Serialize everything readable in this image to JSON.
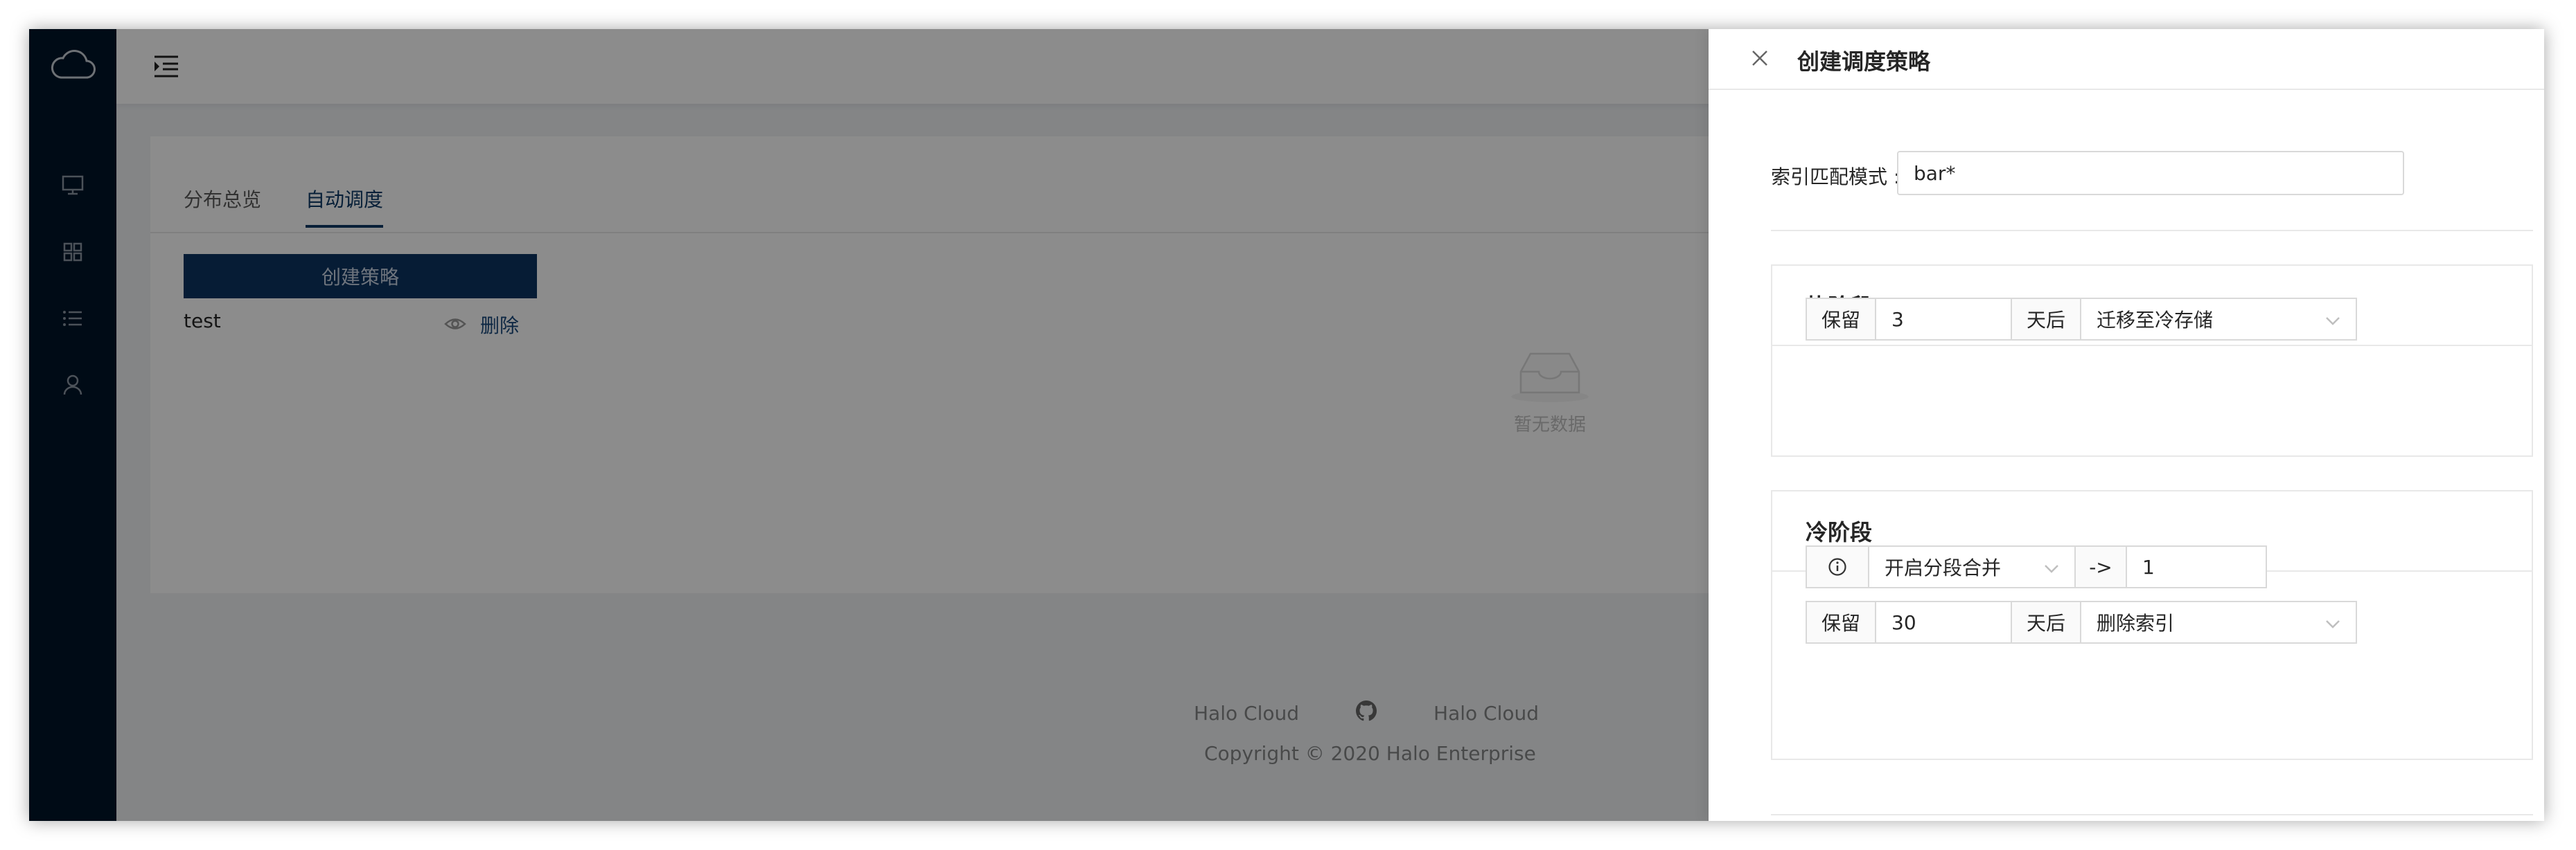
{
  "tabs": [
    {
      "label": "分布总览"
    },
    {
      "label": "自动调度"
    }
  ],
  "actions": {
    "create_policy": "创建策略"
  },
  "policies": [
    {
      "name": "test",
      "delete_label": "删除"
    }
  ],
  "empty": {
    "text": "暂无数据"
  },
  "footer": {
    "link1": "Halo Cloud",
    "link2": "Halo Cloud",
    "copyright": "Copyright © 2020 Halo Enterprise"
  },
  "drawer": {
    "title": "创建调度策略",
    "index_pattern_label": "索引匹配模式 :",
    "index_pattern_value": "bar*",
    "hot": {
      "title": "热阶段",
      "keep_label": "保留",
      "keep_days": "3",
      "after_label": "天后",
      "action": "迁移至冷存储"
    },
    "cold": {
      "title": "冷阶段",
      "merge_option": "开启分段合并",
      "arrow": "->",
      "merge_value": "1",
      "keep_label": "保留",
      "keep_days": "30",
      "after_label": "天后",
      "action": "删除索引"
    }
  },
  "colors": {
    "sider": "#001529",
    "primary": "#0b3461",
    "link": "#1a4a7c"
  }
}
